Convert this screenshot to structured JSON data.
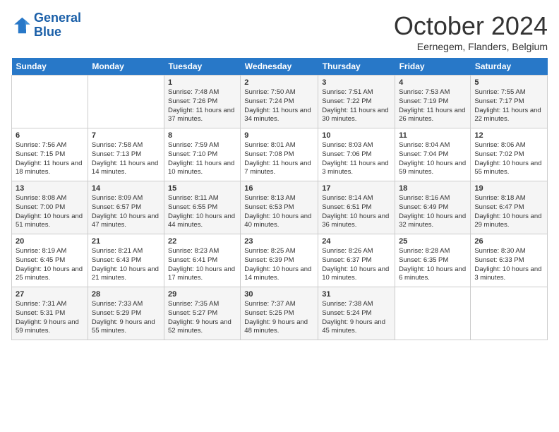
{
  "logo": {
    "line1": "General",
    "line2": "Blue"
  },
  "title": "October 2024",
  "location": "Eernegem, Flanders, Belgium",
  "days_header": [
    "Sunday",
    "Monday",
    "Tuesday",
    "Wednesday",
    "Thursday",
    "Friday",
    "Saturday"
  ],
  "weeks": [
    [
      {
        "day": "",
        "info": ""
      },
      {
        "day": "",
        "info": ""
      },
      {
        "day": "1",
        "info": "Sunrise: 7:48 AM\nSunset: 7:26 PM\nDaylight: 11 hours and 37 minutes."
      },
      {
        "day": "2",
        "info": "Sunrise: 7:50 AM\nSunset: 7:24 PM\nDaylight: 11 hours and 34 minutes."
      },
      {
        "day": "3",
        "info": "Sunrise: 7:51 AM\nSunset: 7:22 PM\nDaylight: 11 hours and 30 minutes."
      },
      {
        "day": "4",
        "info": "Sunrise: 7:53 AM\nSunset: 7:19 PM\nDaylight: 11 hours and 26 minutes."
      },
      {
        "day": "5",
        "info": "Sunrise: 7:55 AM\nSunset: 7:17 PM\nDaylight: 11 hours and 22 minutes."
      }
    ],
    [
      {
        "day": "6",
        "info": "Sunrise: 7:56 AM\nSunset: 7:15 PM\nDaylight: 11 hours and 18 minutes."
      },
      {
        "day": "7",
        "info": "Sunrise: 7:58 AM\nSunset: 7:13 PM\nDaylight: 11 hours and 14 minutes."
      },
      {
        "day": "8",
        "info": "Sunrise: 7:59 AM\nSunset: 7:10 PM\nDaylight: 11 hours and 10 minutes."
      },
      {
        "day": "9",
        "info": "Sunrise: 8:01 AM\nSunset: 7:08 PM\nDaylight: 11 hours and 7 minutes."
      },
      {
        "day": "10",
        "info": "Sunrise: 8:03 AM\nSunset: 7:06 PM\nDaylight: 11 hours and 3 minutes."
      },
      {
        "day": "11",
        "info": "Sunrise: 8:04 AM\nSunset: 7:04 PM\nDaylight: 10 hours and 59 minutes."
      },
      {
        "day": "12",
        "info": "Sunrise: 8:06 AM\nSunset: 7:02 PM\nDaylight: 10 hours and 55 minutes."
      }
    ],
    [
      {
        "day": "13",
        "info": "Sunrise: 8:08 AM\nSunset: 7:00 PM\nDaylight: 10 hours and 51 minutes."
      },
      {
        "day": "14",
        "info": "Sunrise: 8:09 AM\nSunset: 6:57 PM\nDaylight: 10 hours and 47 minutes."
      },
      {
        "day": "15",
        "info": "Sunrise: 8:11 AM\nSunset: 6:55 PM\nDaylight: 10 hours and 44 minutes."
      },
      {
        "day": "16",
        "info": "Sunrise: 8:13 AM\nSunset: 6:53 PM\nDaylight: 10 hours and 40 minutes."
      },
      {
        "day": "17",
        "info": "Sunrise: 8:14 AM\nSunset: 6:51 PM\nDaylight: 10 hours and 36 minutes."
      },
      {
        "day": "18",
        "info": "Sunrise: 8:16 AM\nSunset: 6:49 PM\nDaylight: 10 hours and 32 minutes."
      },
      {
        "day": "19",
        "info": "Sunrise: 8:18 AM\nSunset: 6:47 PM\nDaylight: 10 hours and 29 minutes."
      }
    ],
    [
      {
        "day": "20",
        "info": "Sunrise: 8:19 AM\nSunset: 6:45 PM\nDaylight: 10 hours and 25 minutes."
      },
      {
        "day": "21",
        "info": "Sunrise: 8:21 AM\nSunset: 6:43 PM\nDaylight: 10 hours and 21 minutes."
      },
      {
        "day": "22",
        "info": "Sunrise: 8:23 AM\nSunset: 6:41 PM\nDaylight: 10 hours and 17 minutes."
      },
      {
        "day": "23",
        "info": "Sunrise: 8:25 AM\nSunset: 6:39 PM\nDaylight: 10 hours and 14 minutes."
      },
      {
        "day": "24",
        "info": "Sunrise: 8:26 AM\nSunset: 6:37 PM\nDaylight: 10 hours and 10 minutes."
      },
      {
        "day": "25",
        "info": "Sunrise: 8:28 AM\nSunset: 6:35 PM\nDaylight: 10 hours and 6 minutes."
      },
      {
        "day": "26",
        "info": "Sunrise: 8:30 AM\nSunset: 6:33 PM\nDaylight: 10 hours and 3 minutes."
      }
    ],
    [
      {
        "day": "27",
        "info": "Sunrise: 7:31 AM\nSunset: 5:31 PM\nDaylight: 9 hours and 59 minutes."
      },
      {
        "day": "28",
        "info": "Sunrise: 7:33 AM\nSunset: 5:29 PM\nDaylight: 9 hours and 55 minutes."
      },
      {
        "day": "29",
        "info": "Sunrise: 7:35 AM\nSunset: 5:27 PM\nDaylight: 9 hours and 52 minutes."
      },
      {
        "day": "30",
        "info": "Sunrise: 7:37 AM\nSunset: 5:25 PM\nDaylight: 9 hours and 48 minutes."
      },
      {
        "day": "31",
        "info": "Sunrise: 7:38 AM\nSunset: 5:24 PM\nDaylight: 9 hours and 45 minutes."
      },
      {
        "day": "",
        "info": ""
      },
      {
        "day": "",
        "info": ""
      }
    ]
  ]
}
